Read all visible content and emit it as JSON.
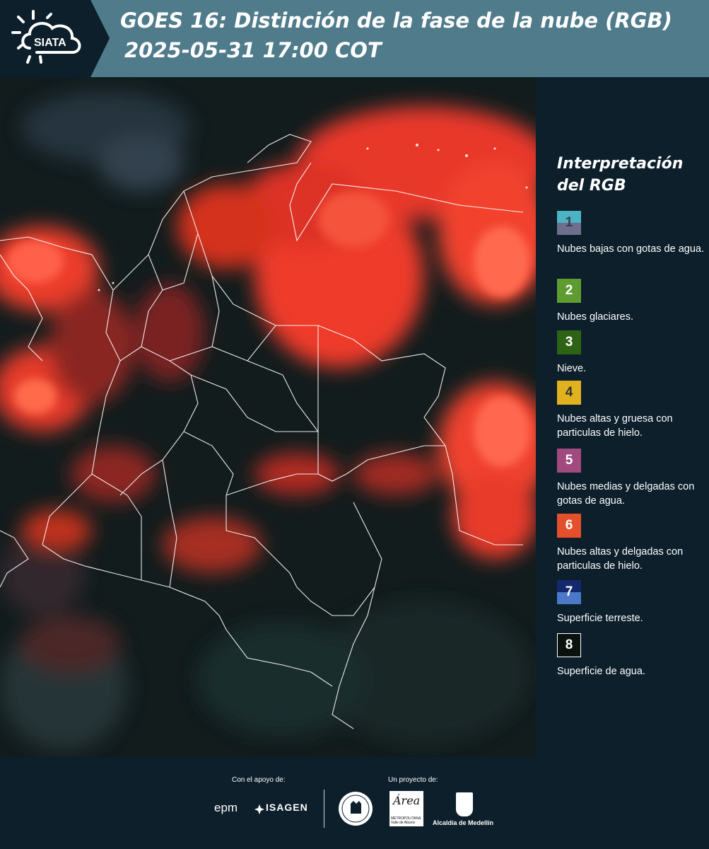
{
  "header": {
    "logo_text": "SIATA",
    "title_line1": "GOES 16: Distinción de la fase de la nube (RGB)",
    "title_line2": "2025-05-31 17:00 COT"
  },
  "map": {
    "imagery": "GOES-16 cloud phase RGB composite over Colombia",
    "border_color": "#ffffff"
  },
  "legend": {
    "title": "Interpretación del RGB",
    "items": [
      {
        "number": "1",
        "label": "Nubes bajas con gotas de agua.",
        "color_top": "#4cb3c4",
        "color_bottom": "#6e6f8c",
        "number_color": "#3a3a4a"
      },
      {
        "number": "2",
        "label": "Nubes glaciares.",
        "color_top": "#5e9c2f",
        "color_bottom": "#5e9c2f",
        "number_color": "#ffffff"
      },
      {
        "number": "3",
        "label": "Nieve.",
        "color_top": "#2e6316",
        "color_bottom": "#2e6316",
        "number_color": "#ffffff"
      },
      {
        "number": "4",
        "label": "Nubes altas y gruesa con particulas de hielo.",
        "color_top": "#e0b21f",
        "color_bottom": "#e0b21f",
        "number_color": "#333333"
      },
      {
        "number": "5",
        "label": "Nubes medias y delgadas con gotas de agua.",
        "color_top": "#a04a7f",
        "color_bottom": "#a04a7f",
        "number_color": "#ffffff"
      },
      {
        "number": "6",
        "label": "Nubes altas y delgadas con particulas de hielo.",
        "color_top": "#e4502b",
        "color_bottom": "#e4502b",
        "number_color": "#ffffff"
      },
      {
        "number": "7",
        "label": "Superficie terreste.",
        "color_top": "#14286e",
        "color_bottom": "#4b78c7",
        "number_color": "#ffffff"
      },
      {
        "number": "8",
        "label": "Superficie de agua.",
        "color_top": "#0a120e",
        "color_bottom": "#0a120e",
        "number_color": "#ffffff"
      }
    ]
  },
  "footer": {
    "support_label": "Con el apoyo de:",
    "project_label": "Un proyecto de:",
    "sponsor1": "epm",
    "sponsor2": "ISAGEN",
    "area_logo": "Área",
    "area_sub": "METROPOLITANA Valle de Aburrá",
    "alcaldia": "Alcaldía de Medellín"
  }
}
